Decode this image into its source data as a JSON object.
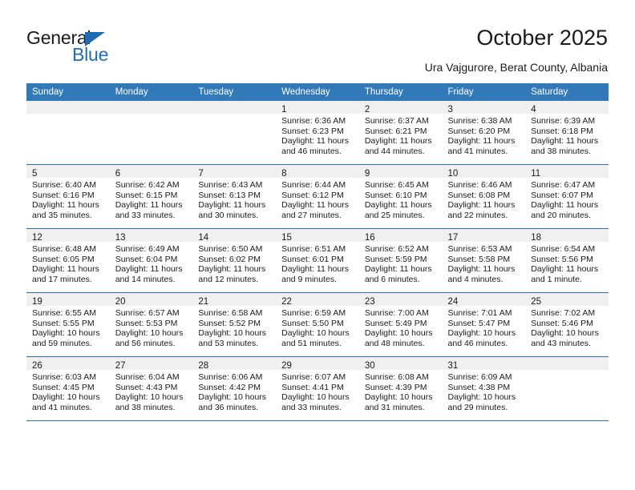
{
  "brand": {
    "name_top": "General",
    "name_bottom": "Blue",
    "accent_color": "#1d6cb4"
  },
  "header": {
    "title": "October 2025",
    "subtitle": "Ura Vajgurore, Berat County, Albania",
    "header_bg_color": "#3179b8",
    "grid_line_color": "#2f6fa8",
    "daynum_band_color": "#f0f0f0"
  },
  "calendar": {
    "weekday_headers": [
      "Sunday",
      "Monday",
      "Tuesday",
      "Wednesday",
      "Thursday",
      "Friday",
      "Saturday"
    ],
    "weeks": [
      [
        {
          "day": "",
          "empty": true
        },
        {
          "day": "",
          "empty": true
        },
        {
          "day": "",
          "empty": true
        },
        {
          "day": "1",
          "sunrise": "Sunrise: 6:36 AM",
          "sunset": "Sunset: 6:23 PM",
          "daylight": "Daylight: 11 hours and 46 minutes."
        },
        {
          "day": "2",
          "sunrise": "Sunrise: 6:37 AM",
          "sunset": "Sunset: 6:21 PM",
          "daylight": "Daylight: 11 hours and 44 minutes."
        },
        {
          "day": "3",
          "sunrise": "Sunrise: 6:38 AM",
          "sunset": "Sunset: 6:20 PM",
          "daylight": "Daylight: 11 hours and 41 minutes."
        },
        {
          "day": "4",
          "sunrise": "Sunrise: 6:39 AM",
          "sunset": "Sunset: 6:18 PM",
          "daylight": "Daylight: 11 hours and 38 minutes."
        }
      ],
      [
        {
          "day": "5",
          "sunrise": "Sunrise: 6:40 AM",
          "sunset": "Sunset: 6:16 PM",
          "daylight": "Daylight: 11 hours and 35 minutes."
        },
        {
          "day": "6",
          "sunrise": "Sunrise: 6:42 AM",
          "sunset": "Sunset: 6:15 PM",
          "daylight": "Daylight: 11 hours and 33 minutes."
        },
        {
          "day": "7",
          "sunrise": "Sunrise: 6:43 AM",
          "sunset": "Sunset: 6:13 PM",
          "daylight": "Daylight: 11 hours and 30 minutes."
        },
        {
          "day": "8",
          "sunrise": "Sunrise: 6:44 AM",
          "sunset": "Sunset: 6:12 PM",
          "daylight": "Daylight: 11 hours and 27 minutes."
        },
        {
          "day": "9",
          "sunrise": "Sunrise: 6:45 AM",
          "sunset": "Sunset: 6:10 PM",
          "daylight": "Daylight: 11 hours and 25 minutes."
        },
        {
          "day": "10",
          "sunrise": "Sunrise: 6:46 AM",
          "sunset": "Sunset: 6:08 PM",
          "daylight": "Daylight: 11 hours and 22 minutes."
        },
        {
          "day": "11",
          "sunrise": "Sunrise: 6:47 AM",
          "sunset": "Sunset: 6:07 PM",
          "daylight": "Daylight: 11 hours and 20 minutes."
        }
      ],
      [
        {
          "day": "12",
          "sunrise": "Sunrise: 6:48 AM",
          "sunset": "Sunset: 6:05 PM",
          "daylight": "Daylight: 11 hours and 17 minutes."
        },
        {
          "day": "13",
          "sunrise": "Sunrise: 6:49 AM",
          "sunset": "Sunset: 6:04 PM",
          "daylight": "Daylight: 11 hours and 14 minutes."
        },
        {
          "day": "14",
          "sunrise": "Sunrise: 6:50 AM",
          "sunset": "Sunset: 6:02 PM",
          "daylight": "Daylight: 11 hours and 12 minutes."
        },
        {
          "day": "15",
          "sunrise": "Sunrise: 6:51 AM",
          "sunset": "Sunset: 6:01 PM",
          "daylight": "Daylight: 11 hours and 9 minutes."
        },
        {
          "day": "16",
          "sunrise": "Sunrise: 6:52 AM",
          "sunset": "Sunset: 5:59 PM",
          "daylight": "Daylight: 11 hours and 6 minutes."
        },
        {
          "day": "17",
          "sunrise": "Sunrise: 6:53 AM",
          "sunset": "Sunset: 5:58 PM",
          "daylight": "Daylight: 11 hours and 4 minutes."
        },
        {
          "day": "18",
          "sunrise": "Sunrise: 6:54 AM",
          "sunset": "Sunset: 5:56 PM",
          "daylight": "Daylight: 11 hours and 1 minute."
        }
      ],
      [
        {
          "day": "19",
          "sunrise": "Sunrise: 6:55 AM",
          "sunset": "Sunset: 5:55 PM",
          "daylight": "Daylight: 10 hours and 59 minutes."
        },
        {
          "day": "20",
          "sunrise": "Sunrise: 6:57 AM",
          "sunset": "Sunset: 5:53 PM",
          "daylight": "Daylight: 10 hours and 56 minutes."
        },
        {
          "day": "21",
          "sunrise": "Sunrise: 6:58 AM",
          "sunset": "Sunset: 5:52 PM",
          "daylight": "Daylight: 10 hours and 53 minutes."
        },
        {
          "day": "22",
          "sunrise": "Sunrise: 6:59 AM",
          "sunset": "Sunset: 5:50 PM",
          "daylight": "Daylight: 10 hours and 51 minutes."
        },
        {
          "day": "23",
          "sunrise": "Sunrise: 7:00 AM",
          "sunset": "Sunset: 5:49 PM",
          "daylight": "Daylight: 10 hours and 48 minutes."
        },
        {
          "day": "24",
          "sunrise": "Sunrise: 7:01 AM",
          "sunset": "Sunset: 5:47 PM",
          "daylight": "Daylight: 10 hours and 46 minutes."
        },
        {
          "day": "25",
          "sunrise": "Sunrise: 7:02 AM",
          "sunset": "Sunset: 5:46 PM",
          "daylight": "Daylight: 10 hours and 43 minutes."
        }
      ],
      [
        {
          "day": "26",
          "sunrise": "Sunrise: 6:03 AM",
          "sunset": "Sunset: 4:45 PM",
          "daylight": "Daylight: 10 hours and 41 minutes."
        },
        {
          "day": "27",
          "sunrise": "Sunrise: 6:04 AM",
          "sunset": "Sunset: 4:43 PM",
          "daylight": "Daylight: 10 hours and 38 minutes."
        },
        {
          "day": "28",
          "sunrise": "Sunrise: 6:06 AM",
          "sunset": "Sunset: 4:42 PM",
          "daylight": "Daylight: 10 hours and 36 minutes."
        },
        {
          "day": "29",
          "sunrise": "Sunrise: 6:07 AM",
          "sunset": "Sunset: 4:41 PM",
          "daylight": "Daylight: 10 hours and 33 minutes."
        },
        {
          "day": "30",
          "sunrise": "Sunrise: 6:08 AM",
          "sunset": "Sunset: 4:39 PM",
          "daylight": "Daylight: 10 hours and 31 minutes."
        },
        {
          "day": "31",
          "sunrise": "Sunrise: 6:09 AM",
          "sunset": "Sunset: 4:38 PM",
          "daylight": "Daylight: 10 hours and 29 minutes."
        },
        {
          "day": "",
          "empty": true
        }
      ]
    ]
  }
}
